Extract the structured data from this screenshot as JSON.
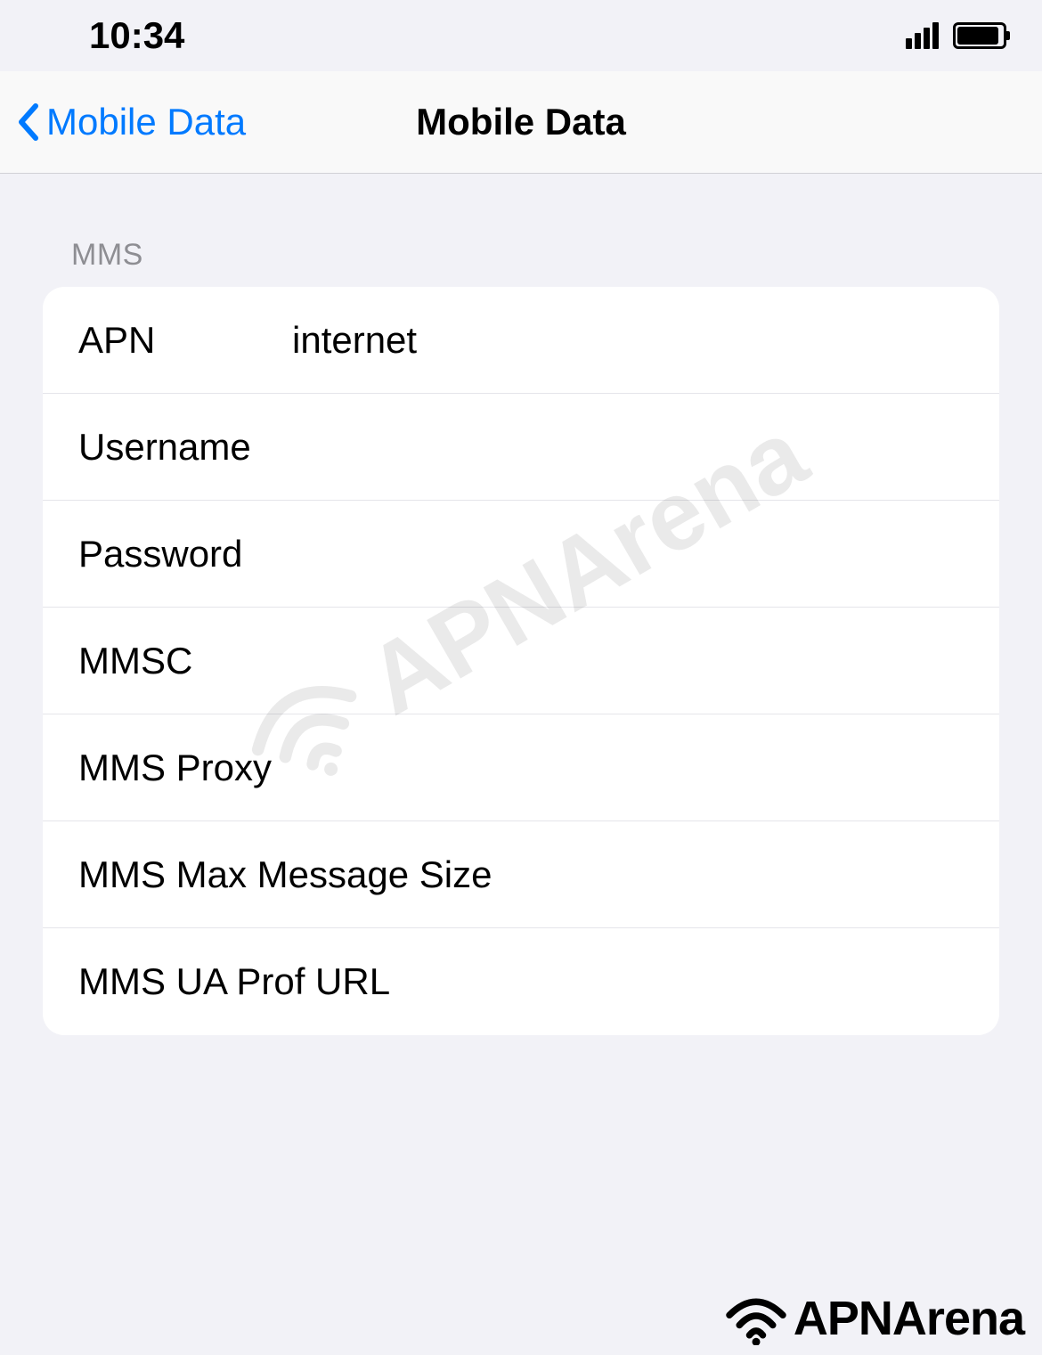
{
  "status_bar": {
    "time": "10:34"
  },
  "nav": {
    "back_label": "Mobile Data",
    "title": "Mobile Data"
  },
  "section": {
    "header": "MMS",
    "rows": [
      {
        "label": "APN",
        "value": "internet"
      },
      {
        "label": "Username",
        "value": ""
      },
      {
        "label": "Password",
        "value": ""
      },
      {
        "label": "MMSC",
        "value": ""
      },
      {
        "label": "MMS Proxy",
        "value": ""
      },
      {
        "label": "MMS Max Message Size",
        "value": ""
      },
      {
        "label": "MMS UA Prof URL",
        "value": ""
      }
    ]
  },
  "branding": {
    "name": "APNArena"
  }
}
